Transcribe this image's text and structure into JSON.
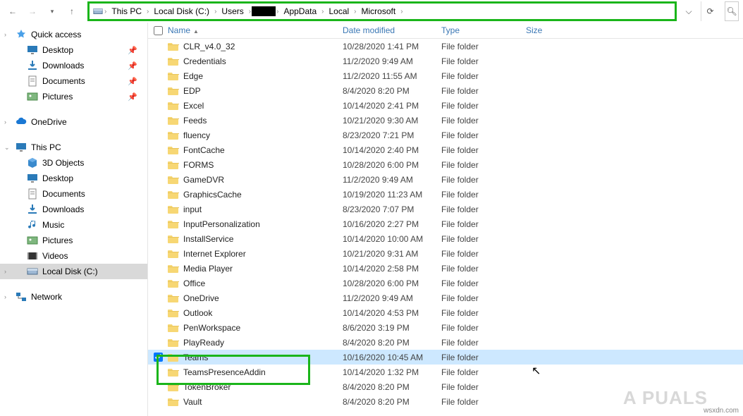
{
  "breadcrumbs": {
    "b0": "This PC",
    "b1": "Local Disk (C:)",
    "b2": "Users",
    "b4": "AppData",
    "b5": "Local",
    "b6": "Microsoft"
  },
  "sidebar": {
    "quick_access": "Quick access",
    "desktop": "Desktop",
    "downloads": "Downloads",
    "documents": "Documents",
    "pictures": "Pictures",
    "onedrive": "OneDrive",
    "this_pc": "This PC",
    "threed": "3D Objects",
    "pc_desktop": "Desktop",
    "pc_documents": "Documents",
    "pc_downloads": "Downloads",
    "pc_music": "Music",
    "pc_pictures": "Pictures",
    "pc_videos": "Videos",
    "local_disk": "Local Disk (C:)",
    "network": "Network"
  },
  "columns": {
    "name": "Name",
    "date": "Date modified",
    "type": "Type",
    "size": "Size"
  },
  "type_label": "File folder",
  "files": [
    {
      "name": "CLR_v4.0_32",
      "date": "10/28/2020 1:41 PM"
    },
    {
      "name": "Credentials",
      "date": "11/2/2020 9:49 AM"
    },
    {
      "name": "Edge",
      "date": "11/2/2020 11:55 AM"
    },
    {
      "name": "EDP",
      "date": "8/4/2020 8:20 PM"
    },
    {
      "name": "Excel",
      "date": "10/14/2020 2:41 PM"
    },
    {
      "name": "Feeds",
      "date": "10/21/2020 9:30 AM"
    },
    {
      "name": "fluency",
      "date": "8/23/2020 7:21 PM"
    },
    {
      "name": "FontCache",
      "date": "10/14/2020 2:40 PM"
    },
    {
      "name": "FORMS",
      "date": "10/28/2020 6:00 PM"
    },
    {
      "name": "GameDVR",
      "date": "11/2/2020 9:49 AM"
    },
    {
      "name": "GraphicsCache",
      "date": "10/19/2020 11:23 AM"
    },
    {
      "name": "input",
      "date": "8/23/2020 7:07 PM"
    },
    {
      "name": "InputPersonalization",
      "date": "10/16/2020 2:27 PM"
    },
    {
      "name": "InstallService",
      "date": "10/14/2020 10:00 AM"
    },
    {
      "name": "Internet Explorer",
      "date": "10/21/2020 9:31 AM"
    },
    {
      "name": "Media Player",
      "date": "10/14/2020 2:58 PM"
    },
    {
      "name": "Office",
      "date": "10/28/2020 6:00 PM"
    },
    {
      "name": "OneDrive",
      "date": "11/2/2020 9:49 AM"
    },
    {
      "name": "Outlook",
      "date": "10/14/2020 4:53 PM"
    },
    {
      "name": "PenWorkspace",
      "date": "8/6/2020 3:19 PM"
    },
    {
      "name": "PlayReady",
      "date": "8/4/2020 8:20 PM"
    },
    {
      "name": "Teams",
      "date": "10/16/2020 10:45 AM",
      "selected": true
    },
    {
      "name": "TeamsPresenceAddin",
      "date": "10/14/2020 1:32 PM"
    },
    {
      "name": "TokenBroker",
      "date": "8/4/2020 8:20 PM"
    },
    {
      "name": "Vault",
      "date": "8/4/2020 8:20 PM"
    }
  ],
  "watermark": "wsxdn.com",
  "logo_watermark": "A   PUALS"
}
